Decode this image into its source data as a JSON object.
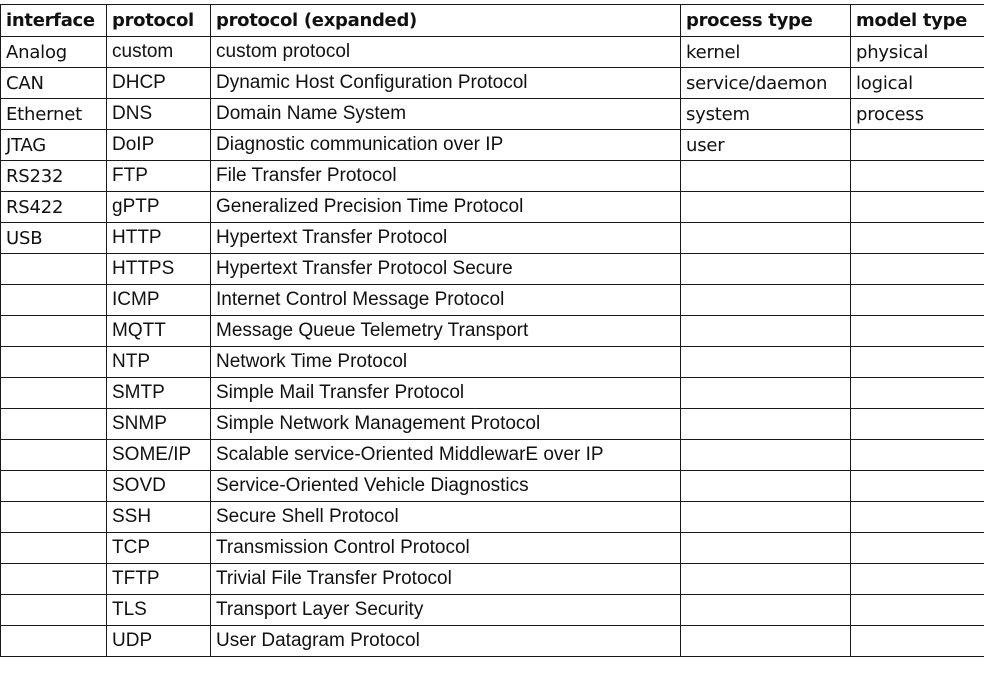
{
  "headers": {
    "interface": "interface",
    "protocol": "protocol",
    "protocol_expanded": "protocol (expanded)",
    "process_type": "process type",
    "model_type": "model type"
  },
  "rows": [
    {
      "interface": "Analog",
      "protocol": "custom",
      "expanded": "custom protocol",
      "process": "kernel",
      "model": "physical"
    },
    {
      "interface": "CAN",
      "protocol": "DHCP",
      "expanded": "Dynamic Host Configuration Protocol",
      "process": "service/daemon",
      "model": "logical"
    },
    {
      "interface": "Ethernet",
      "protocol": "DNS",
      "expanded": "Domain Name System",
      "process": "system",
      "model": "process"
    },
    {
      "interface": "JTAG",
      "protocol": "DoIP",
      "expanded": "Diagnostic communication over IP",
      "process": "user",
      "model": ""
    },
    {
      "interface": "RS232",
      "protocol": "FTP",
      "expanded": "File Transfer Protocol",
      "process": "",
      "model": ""
    },
    {
      "interface": "RS422",
      "protocol": "gPTP",
      "expanded": "Generalized Precision Time Protocol",
      "process": "",
      "model": ""
    },
    {
      "interface": "USB",
      "protocol": "HTTP",
      "expanded": "Hypertext Transfer Protocol",
      "process": "",
      "model": ""
    },
    {
      "interface": "",
      "protocol": "HTTPS",
      "expanded": "Hypertext Transfer Protocol Secure",
      "process": "",
      "model": ""
    },
    {
      "interface": "",
      "protocol": "ICMP",
      "expanded": "Internet Control Message Protocol",
      "process": "",
      "model": ""
    },
    {
      "interface": "",
      "protocol": "MQTT",
      "expanded": "Message Queue Telemetry Transport",
      "process": "",
      "model": ""
    },
    {
      "interface": "",
      "protocol": "NTP",
      "expanded": "Network Time Protocol",
      "process": "",
      "model": ""
    },
    {
      "interface": "",
      "protocol": "SMTP",
      "expanded": "Simple Mail Transfer Protocol",
      "process": "",
      "model": ""
    },
    {
      "interface": "",
      "protocol": "SNMP",
      "expanded": "Simple Network Management Protocol",
      "process": "",
      "model": ""
    },
    {
      "interface": "",
      "protocol": "SOME/IP",
      "expanded": "Scalable service-Oriented MiddlewarE over IP",
      "process": "",
      "model": ""
    },
    {
      "interface": "",
      "protocol": "SOVD",
      "expanded": "Service-Oriented Vehicle Diagnostics",
      "process": "",
      "model": ""
    },
    {
      "interface": "",
      "protocol": "SSH",
      "expanded": "Secure Shell Protocol",
      "process": "",
      "model": ""
    },
    {
      "interface": "",
      "protocol": "TCP",
      "expanded": "Transmission Control Protocol",
      "process": "",
      "model": ""
    },
    {
      "interface": "",
      "protocol": "TFTP",
      "expanded": "Trivial File Transfer Protocol",
      "process": "",
      "model": ""
    },
    {
      "interface": "",
      "protocol": "TLS",
      "expanded": "Transport Layer Security",
      "process": "",
      "model": ""
    },
    {
      "interface": "",
      "protocol": "UDP",
      "expanded": "User Datagram Protocol",
      "process": "",
      "model": ""
    }
  ]
}
